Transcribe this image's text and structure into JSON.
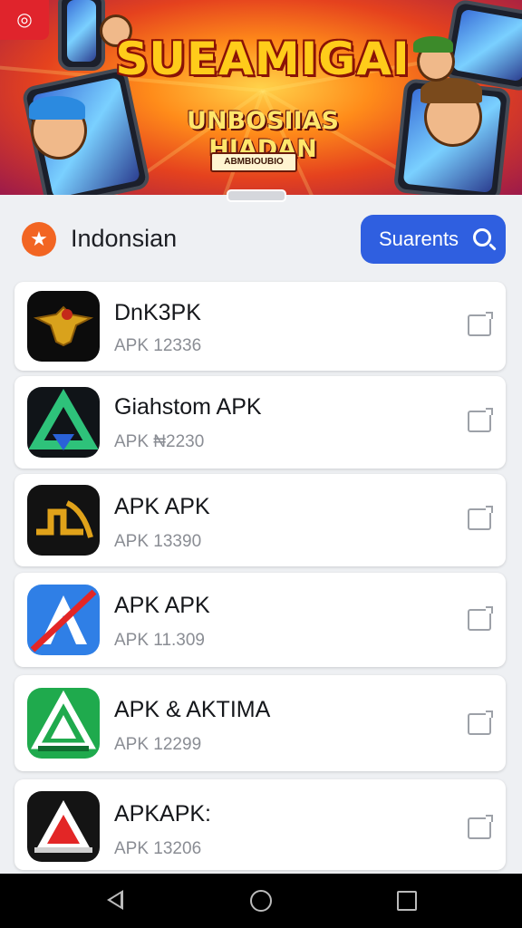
{
  "banner": {
    "title": "SUEAMIGAI",
    "subtitle": "UNBOSIIAS HIADAN",
    "tag": "ABMBIOUBIO"
  },
  "header": {
    "language_label": "Indonsian",
    "search_label": "Suarents"
  },
  "apps": [
    {
      "name": "DnK3PK",
      "meta": "APK 12336",
      "icon": "eagle-logo-icon",
      "bg": "#0c0c0c"
    },
    {
      "name": "Giahstom APK",
      "meta": "APK ₦2230",
      "icon": "green-triangle-icon",
      "bg": "#101418"
    },
    {
      "name": "APK APK",
      "meta": "APK 13390",
      "icon": "gold-wave-icon",
      "bg": "#121212"
    },
    {
      "name": "APK APK",
      "meta": "APK 11.309",
      "icon": "blue-a-icon",
      "bg": "#2f7fe6"
    },
    {
      "name": "APK & AKTIMA",
      "meta": "APK 12299",
      "icon": "green-a-icon",
      "bg": "#1faa4d"
    },
    {
      "name": "APKAPK:",
      "meta": "APK 13206",
      "icon": "red-a-icon",
      "bg": "#141414"
    }
  ],
  "colors": {
    "accent": "#2f5fe0",
    "language_icon": "#f26522",
    "navbar": "#000000"
  }
}
